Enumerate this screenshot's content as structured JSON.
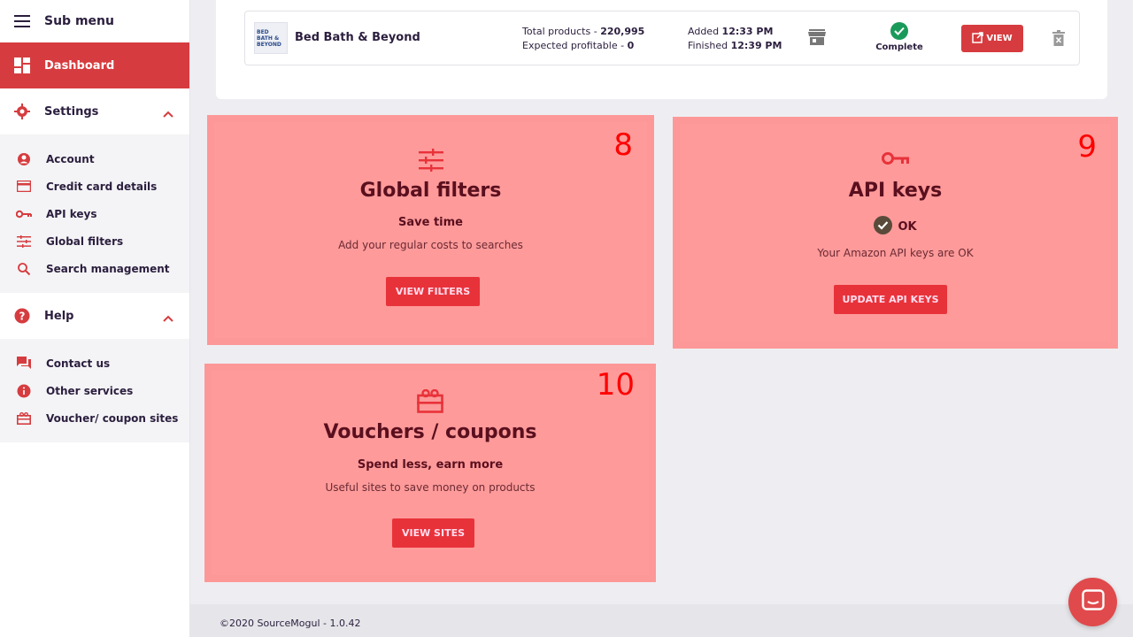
{
  "sidebar": {
    "header": "Sub menu",
    "dashboard": "Dashboard",
    "settings": {
      "label": "Settings",
      "items": [
        "Account",
        "Credit card details",
        "API keys",
        "Global filters",
        "Search management"
      ]
    },
    "help": {
      "label": "Help",
      "items": [
        "Contact us",
        "Other services",
        "Voucher/ coupon sites"
      ]
    }
  },
  "search_row": {
    "logo_text": "BED BATH & BEYOND",
    "store": "Bed Bath & Beyond",
    "total_label": "Total products -",
    "total_value": "220,995",
    "profitable_label": "Expected profitable -",
    "profitable_value": "0",
    "added_label": "Added",
    "added_time": "12:33 PM",
    "finished_label": "Finished",
    "finished_time": "12:39 PM",
    "status": "Complete",
    "view_label": "VIEW"
  },
  "cards": {
    "filters": {
      "number": "8",
      "title": "Global filters",
      "subtitle": "Save time",
      "description": "Add your regular costs to searches",
      "button": "VIEW FILTERS"
    },
    "api": {
      "number": "9",
      "title": "API keys",
      "status": "OK",
      "description": "Your Amazon API keys are OK",
      "button": "UPDATE API KEYS"
    },
    "vouchers": {
      "number": "10",
      "title": "Vouchers / coupons",
      "subtitle": "Spend less, earn more",
      "description": "Useful sites to save money on products",
      "button": "VIEW SITES"
    }
  },
  "footer": {
    "copyright": "©2020 SourceMogul - 1.0.42"
  },
  "colors": {
    "brand_red": "#d63c3f",
    "card_overlay": "#fd9898",
    "success_green": "#1a9a5a"
  }
}
